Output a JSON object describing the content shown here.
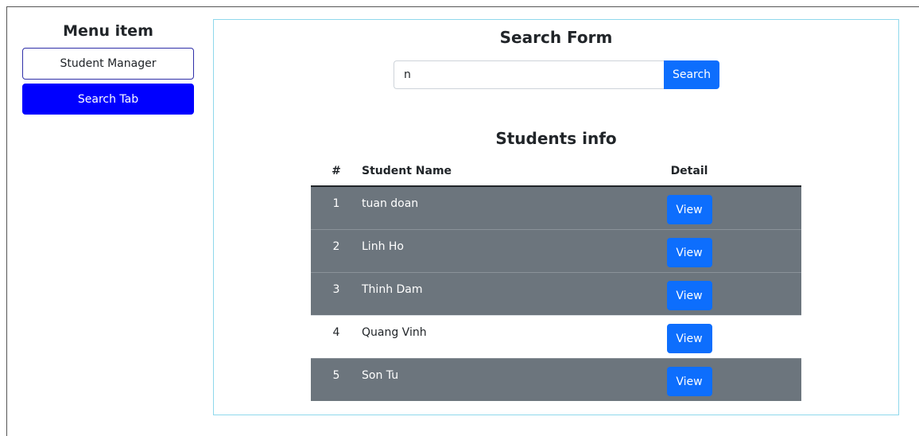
{
  "sidebar": {
    "title": "Menu item",
    "items": [
      {
        "label": "Student Manager"
      },
      {
        "label": "Search Tab"
      }
    ]
  },
  "search": {
    "title": "Search Form",
    "value": "n",
    "button_label": "Search"
  },
  "students": {
    "title": "Students info",
    "headers": {
      "num": "#",
      "name": "Student Name",
      "detail": "Detail"
    },
    "rows": [
      {
        "num": "1",
        "name": "tuan doan",
        "action": "View"
      },
      {
        "num": "2",
        "name": "Linh Ho",
        "action": "View"
      },
      {
        "num": "3",
        "name": "Thinh Dam",
        "action": "View"
      },
      {
        "num": "4",
        "name": "Quang Vinh",
        "action": "View"
      },
      {
        "num": "5",
        "name": "Son Tu",
        "action": "View"
      }
    ]
  },
  "colors": {
    "primary": "#0d6efd",
    "active_tab": "#0000ff",
    "dark_row": "#6c757d",
    "panel_border": "#8fd8ec"
  }
}
